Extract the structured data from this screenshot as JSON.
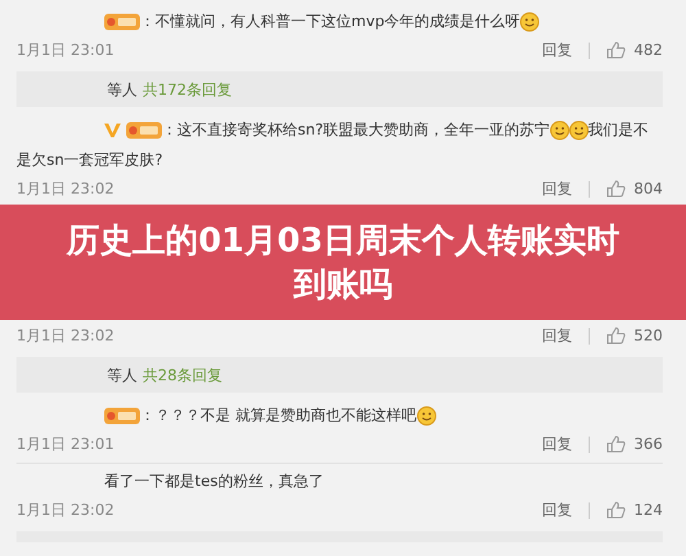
{
  "feed": [
    {
      "kind": "comment",
      "parts": [
        {
          "kind": "badge"
        },
        {
          "kind": "text",
          "text": "：不懂就问，有人科普一下这位mvp今年的成绩是什么呀"
        },
        {
          "kind": "emoji"
        }
      ],
      "time": "1月1日 23:01",
      "reply_label": "回复",
      "likes": "482",
      "replies": {
        "prefix": "等人",
        "link": "共172条回复"
      }
    },
    {
      "kind": "comment",
      "parts": [
        {
          "kind": "verified"
        },
        {
          "kind": "badge"
        },
        {
          "kind": "text",
          "text": "：这不直接寄奖杯给sn?联盟最大赞助商，全年一亚的苏宁"
        },
        {
          "kind": "emoji"
        },
        {
          "kind": "emoji"
        },
        {
          "kind": "text",
          "text": "我们是不是欠sn一套冠军皮肤?"
        }
      ],
      "time": "1月1日 23:02",
      "reply_label": "回复",
      "likes": "804"
    },
    {
      "kind": "banner",
      "title": "历史上的01月03日周末个人转账实时到账吗"
    },
    {
      "kind": "comment",
      "time": "1月1日 23:02",
      "reply_label": "回复",
      "likes": "520",
      "replies": {
        "prefix": "等人",
        "link": "共28条回复"
      }
    },
    {
      "kind": "comment",
      "parts": [
        {
          "kind": "badge"
        },
        {
          "kind": "text",
          "text": "：？？？不是 就算是赞助商也不能这样吧"
        },
        {
          "kind": "emoji"
        }
      ],
      "time": "1月1日 23:01",
      "reply_label": "回复",
      "likes": "366"
    },
    {
      "kind": "comment",
      "parts": [
        {
          "kind": "text",
          "text": "看了一下都是tes的粉丝，真急了"
        }
      ],
      "time": "1月1日 23:02",
      "reply_label": "回复",
      "likes": "124"
    }
  ]
}
